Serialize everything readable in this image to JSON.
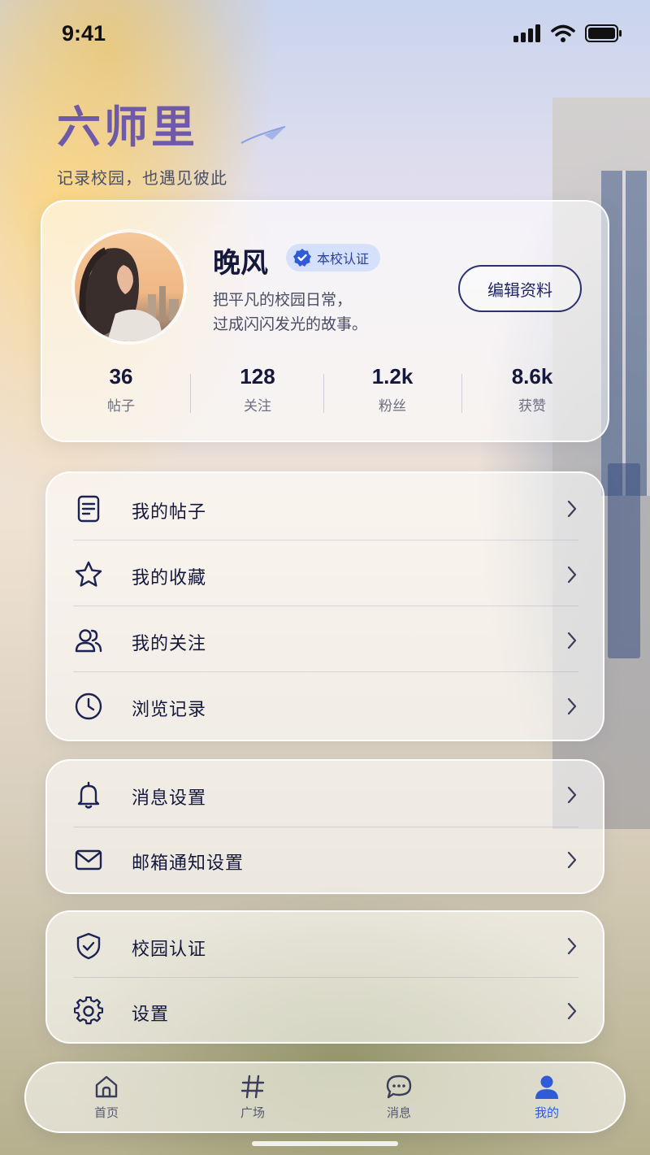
{
  "status_bar": {
    "time": "9:41"
  },
  "brand": {
    "name": "六师里",
    "slogan": "记录校园，也遇见彼此"
  },
  "profile": {
    "name": "晚风",
    "badge": "本校认证",
    "bio_line1": "把平凡的校园日常，",
    "bio_line2": "过成闪闪发光的故事。",
    "edit_label": "编辑资料",
    "stats": [
      {
        "value": "36",
        "label": "帖子"
      },
      {
        "value": "128",
        "label": "关注"
      },
      {
        "value": "1.2k",
        "label": "粉丝"
      },
      {
        "value": "8.6k",
        "label": "获赞"
      }
    ]
  },
  "menu_groups": [
    {
      "items": [
        {
          "label": "我的帖子",
          "icon": "document-icon"
        },
        {
          "label": "我的收藏",
          "icon": "star-icon"
        },
        {
          "label": "我的关注",
          "icon": "users-icon"
        },
        {
          "label": "浏览记录",
          "icon": "clock-icon"
        }
      ]
    },
    {
      "items": [
        {
          "label": "消息设置",
          "icon": "bell-icon"
        },
        {
          "label": "邮箱通知设置",
          "icon": "mail-icon"
        }
      ]
    },
    {
      "items": [
        {
          "label": "校园认证",
          "icon": "shield-check-icon"
        },
        {
          "label": "设置",
          "icon": "gear-icon"
        }
      ]
    }
  ],
  "tab_bar": {
    "tabs": [
      {
        "label": "首页",
        "icon": "home-icon"
      },
      {
        "label": "广场",
        "icon": "hashtag-icon"
      },
      {
        "label": "消息",
        "icon": "chat-icon"
      },
      {
        "label": "我的",
        "icon": "person-icon"
      }
    ],
    "active_index": 3
  },
  "colors": {
    "accent": "#2f5bd8",
    "text_dark": "#14183c",
    "brand_purple": "#6e5aa8"
  }
}
